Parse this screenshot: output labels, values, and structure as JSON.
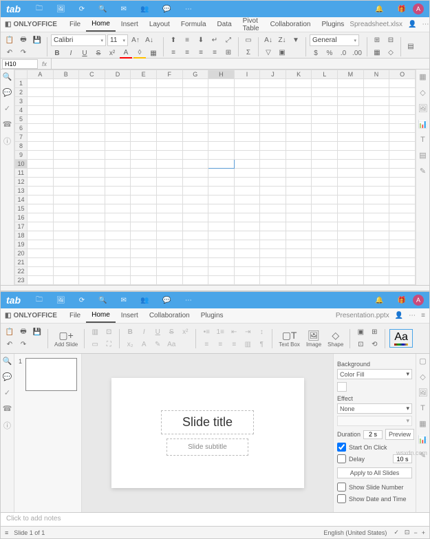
{
  "spreadsheet": {
    "logo": "tab",
    "app_name": "ONLYOFFICE",
    "doc_name": "Spreadsheet.xlsx",
    "menus": [
      "File",
      "Home",
      "Insert",
      "Layout",
      "Formula",
      "Data",
      "Pivot Table",
      "Collaboration",
      "Plugins"
    ],
    "active_menu": "Home",
    "font_name": "Calibri",
    "font_size": "11",
    "number_format": "General",
    "cell_ref": "H10",
    "columns": [
      "A",
      "B",
      "C",
      "D",
      "E",
      "F",
      "G",
      "H",
      "I",
      "J",
      "K",
      "L",
      "M",
      "N",
      "O"
    ],
    "rows": [
      "1",
      "2",
      "3",
      "4",
      "5",
      "6",
      "7",
      "8",
      "9",
      "10",
      "11",
      "12",
      "13",
      "14",
      "15",
      "16",
      "17",
      "18",
      "19",
      "20",
      "21",
      "22",
      "23"
    ],
    "sel_col": "H",
    "sel_row": "10",
    "avatar": "A"
  },
  "presentation": {
    "logo": "tab",
    "app_name": "ONLYOFFICE",
    "doc_name": "Presentation.pptx",
    "menus": [
      "File",
      "Home",
      "Insert",
      "Collaboration",
      "Plugins"
    ],
    "active_menu": "Home",
    "add_slide": "Add Slide",
    "text_box": "Text Box",
    "image": "Image",
    "shape": "Shape",
    "aa": "Aa",
    "slide_title": "Slide title",
    "slide_subtitle": "Slide subtitle",
    "thumb_num": "1",
    "notes_placeholder": "Click to add notes",
    "prop": {
      "background": "Background",
      "bg_value": "Color Fill",
      "effect": "Effect",
      "effect_value": "None",
      "duration_lbl": "Duration",
      "duration_val": "2 s",
      "preview": "Preview",
      "start_on_click": "Start On Click",
      "delay_lbl": "Delay",
      "delay_val": "10 s",
      "apply_all": "Apply to All Slides",
      "show_num": "Show Slide Number",
      "show_date": "Show Date and Time"
    },
    "status": "Slide 1 of 1",
    "lang": "English (United States)",
    "avatar": "A"
  },
  "watermark": "wsxdn.com"
}
